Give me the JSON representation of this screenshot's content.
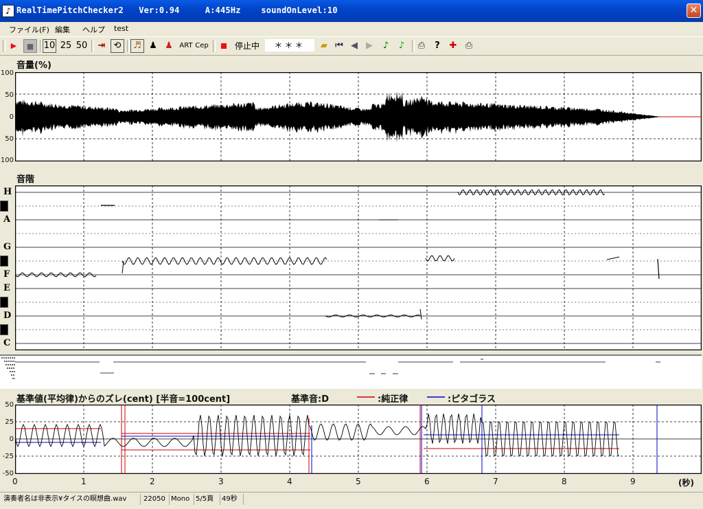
{
  "window": {
    "title": "RealTimePitchChecker2   Ver:0.94     A:445Hz    soundOnLevel:10",
    "close_glyph": "✕"
  },
  "menu": [
    "ファイル(F)",
    "編集",
    "ヘルプ",
    "test"
  ],
  "toolbar": {
    "play_glyph": "▶",
    "stop_glyph": "■",
    "speed_10": "10",
    "speed_25": "25",
    "speed_50": "50",
    "art": "ART",
    "cep": "Cep",
    "status": "停止中",
    "note_display": "＊＊＊"
  },
  "volume": {
    "label": "音量(%)",
    "ticks": [
      "100",
      "50",
      "0",
      "50",
      "100"
    ]
  },
  "scale": {
    "label": "音階",
    "notes": [
      "H",
      "A",
      "G",
      "F",
      "E",
      "D",
      "C"
    ]
  },
  "deviation": {
    "label": "基準値(平均律)からのズレ(cent) [半音=100cent]",
    "base_note": "基準音:D",
    "legend": [
      {
        "name": ":純正律",
        "color": "#cc0000"
      },
      {
        "name": ":ピタゴラス",
        "color": "#0000cc"
      }
    ],
    "ticks": [
      "50",
      "25",
      "0",
      "-25",
      "-50"
    ]
  },
  "time_axis": {
    "ticks": [
      "0",
      "1",
      "2",
      "3",
      "4",
      "5",
      "6",
      "7",
      "8",
      "9"
    ],
    "unit": "(秒)"
  },
  "statusbar": {
    "file": "演奏者名は非表示¥タイスの瞑想曲.wav",
    "rate": "22050",
    "channel": "Mono",
    "page": "5/5頁",
    "duration": "49秒"
  }
}
